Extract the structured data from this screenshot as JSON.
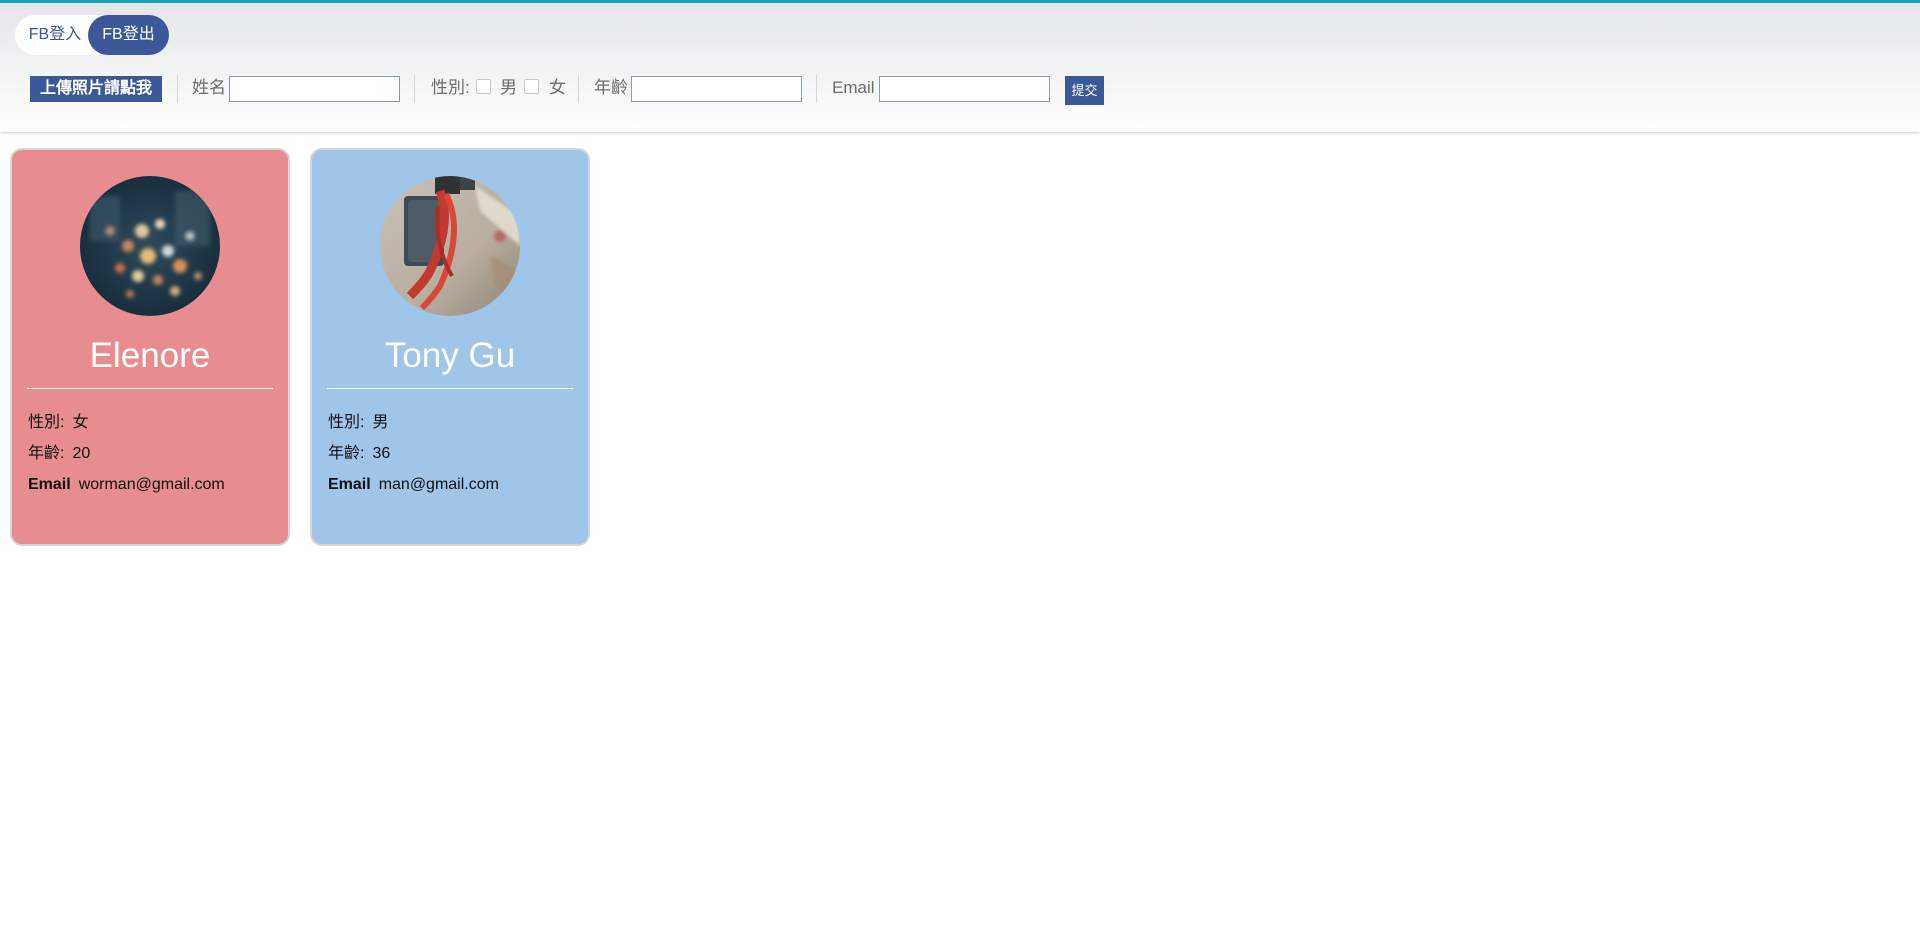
{
  "header": {
    "fb_login_label": "FB登入",
    "fb_logout_label": "FB登出"
  },
  "form": {
    "upload_label": "上傳照片請點我",
    "name_label": "姓名",
    "name_value": "",
    "gender_label": "性別:",
    "gender_male_label": "男",
    "gender_female_label": "女",
    "age_label": "年齡",
    "age_value": "",
    "email_label": "Email",
    "email_value": "",
    "submit_label": "提交"
  },
  "cards": [
    {
      "name": "Elenore",
      "bg_color": "#e88d8f",
      "gender_label": "性別:",
      "gender": "女",
      "age_label": "年齡:",
      "age": "20",
      "email_label": "Email",
      "email": "worman@gmail.com",
      "avatar_icon": "city-lights-photo"
    },
    {
      "name": "Tony Gu",
      "bg_color": "#9fc5e8",
      "gender_label": "性別:",
      "gender": "男",
      "age_label": "年齡:",
      "age": "36",
      "email_label": "Email",
      "email": "man@gmail.com",
      "avatar_icon": "camera-strap-photo"
    }
  ]
}
